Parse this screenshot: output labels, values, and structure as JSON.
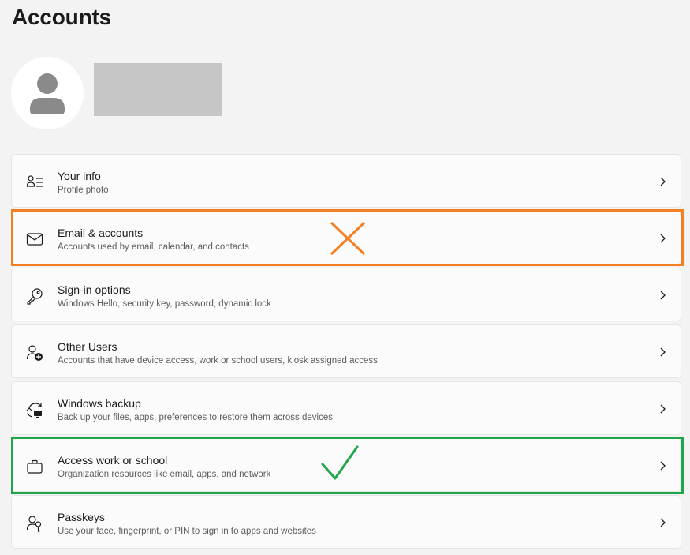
{
  "page": {
    "title": "Accounts"
  },
  "user": {
    "avatar_icon": "person-icon"
  },
  "items": [
    {
      "title": "Your info",
      "subtitle": "Profile photo",
      "icon": "person-list-icon"
    },
    {
      "title": "Email & accounts",
      "subtitle": "Accounts used by email, calendar, and contacts",
      "icon": "mail-icon"
    },
    {
      "title": "Sign-in options",
      "subtitle": "Windows Hello, security key, password, dynamic lock",
      "icon": "key-icon"
    },
    {
      "title": "Other Users",
      "subtitle": "Accounts that have device access, work or school users, kiosk assigned access",
      "icon": "person-add-icon"
    },
    {
      "title": "Windows backup",
      "subtitle": "Back up your files, apps, preferences to restore them across devices",
      "icon": "backup-icon"
    },
    {
      "title": "Access work or school",
      "subtitle": "Organization resources like email, apps, and network",
      "icon": "briefcase-icon"
    },
    {
      "title": "Passkeys",
      "subtitle": "Use your face, fingerprint, or PIN to sign in to apps and websites",
      "icon": "passkey-icon"
    }
  ],
  "annotations": {
    "wrong_color": "#f47f20",
    "right_color": "#1fa64a",
    "wrong_item": "Email & accounts",
    "right_item": "Access work or school"
  }
}
